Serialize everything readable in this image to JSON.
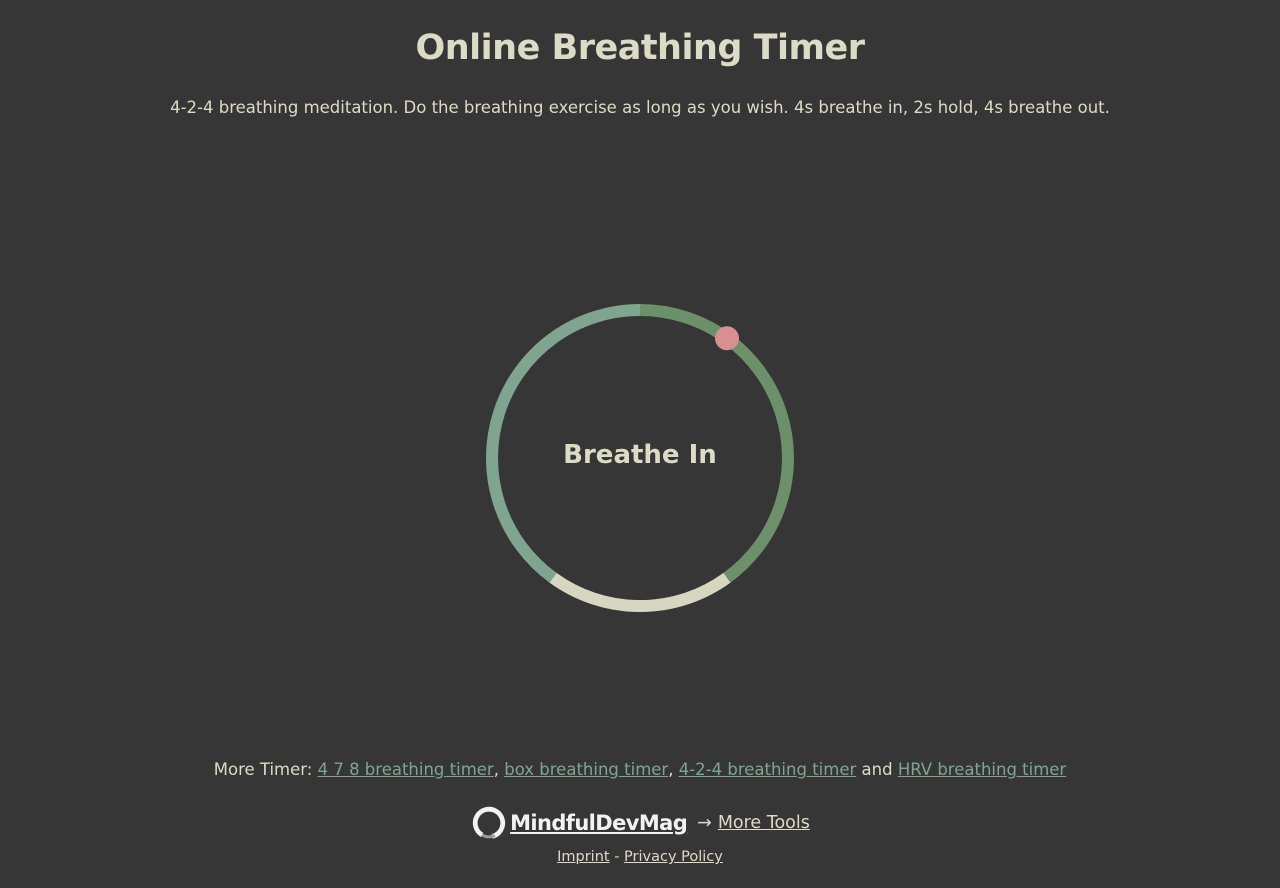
{
  "header": {
    "title": "Online Breathing Timer",
    "description": "4-2-4 breathing meditation. Do the breathing exercise as long as you wish. 4s breathe in, 2s hold, 4s breathe out."
  },
  "timer": {
    "phase_label": "Breathe In",
    "cycle_seconds": {
      "inhale": 4,
      "hold": 2,
      "exhale": 4
    },
    "progress_fraction": 0.1,
    "colors": {
      "inhale_segment": "#7fa590",
      "hold_segment": "#6c9069",
      "exhale_segment": "#d7d7c1",
      "marker": "#d98e92",
      "background": "#363636",
      "text": "#dcdcc6"
    }
  },
  "footer": {
    "more_timer_prefix": "More Timer: ",
    "links": [
      {
        "label": "4 7 8 breathing timer"
      },
      {
        "label": "box breathing timer"
      },
      {
        "label": "4-2-4 breathing timer"
      },
      {
        "label": "HRV breathing timer"
      }
    ],
    "separator": ", ",
    "conjunction": " and ",
    "brand_name": "MindfulDevMag",
    "arrow": "→",
    "more_tools": "More Tools",
    "imprint": "Imprint",
    "legal_separator": " - ",
    "privacy_policy": "Privacy Policy"
  }
}
